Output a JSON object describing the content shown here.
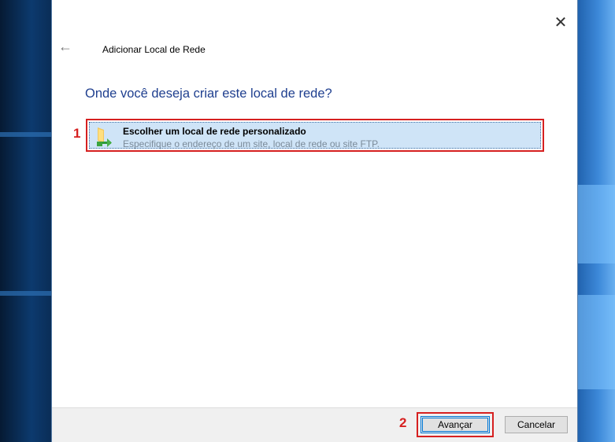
{
  "dialog": {
    "title": "Adicionar Local de Rede",
    "close_label": "✕",
    "back_label": "←",
    "heading": "Onde você deseja criar este local de rede?"
  },
  "option": {
    "title": "Escolher um local de rede personalizado",
    "description": "Especifique o endereço de um site, local de rede ou site FTP.",
    "icon": "network-folder-icon"
  },
  "annotations": {
    "step1": "1",
    "step2": "2"
  },
  "footer": {
    "next_label": "Avançar",
    "cancel_label": "Cancelar"
  },
  "colors": {
    "heading": "#1f3f8f",
    "highlight_border": "#d62020",
    "selection_bg": "#cfe4f7"
  }
}
